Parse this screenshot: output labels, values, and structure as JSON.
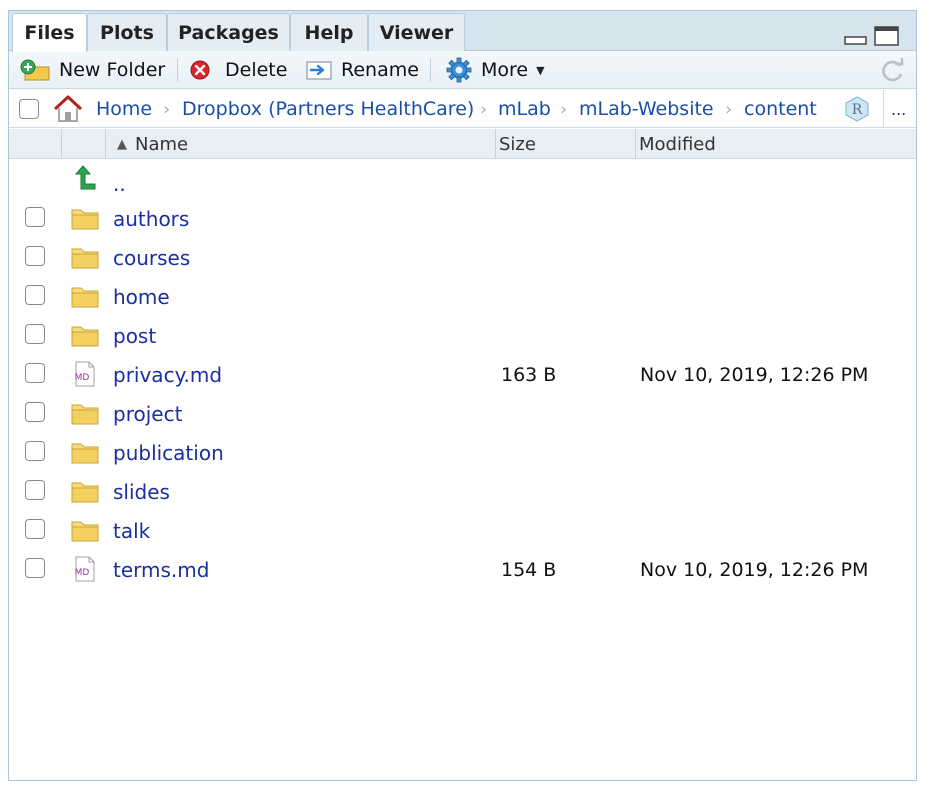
{
  "tabs": [
    {
      "label": "Files",
      "active": true
    },
    {
      "label": "Plots",
      "active": false
    },
    {
      "label": "Packages",
      "active": false
    },
    {
      "label": "Help",
      "active": false
    },
    {
      "label": "Viewer",
      "active": false
    }
  ],
  "toolbar": {
    "new_folder": "New Folder",
    "delete": "Delete",
    "rename": "Rename",
    "more": "More"
  },
  "breadcrumb": {
    "items": [
      "Home",
      "Dropbox (Partners HealthCare)",
      "mLab",
      "mLab-Website",
      "content"
    ],
    "overflow": "..."
  },
  "columns": {
    "name": "Name",
    "size": "Size",
    "modified": "Modified"
  },
  "parent_dir": "..",
  "files": [
    {
      "name": "authors",
      "type": "folder",
      "size": "",
      "modified": ""
    },
    {
      "name": "courses",
      "type": "folder",
      "size": "",
      "modified": ""
    },
    {
      "name": "home",
      "type": "folder",
      "size": "",
      "modified": ""
    },
    {
      "name": "post",
      "type": "folder",
      "size": "",
      "modified": ""
    },
    {
      "name": "privacy.md",
      "type": "markdown",
      "size": "163 B",
      "modified": "Nov 10, 2019, 12:26 PM"
    },
    {
      "name": "project",
      "type": "folder",
      "size": "",
      "modified": ""
    },
    {
      "name": "publication",
      "type": "folder",
      "size": "",
      "modified": ""
    },
    {
      "name": "slides",
      "type": "folder",
      "size": "",
      "modified": ""
    },
    {
      "name": "talk",
      "type": "folder",
      "size": "",
      "modified": ""
    },
    {
      "name": "terms.md",
      "type": "markdown",
      "size": "154 B",
      "modified": "Nov 10, 2019, 12:26 PM"
    }
  ],
  "icons": {
    "md_badge": "MD",
    "r_badge": "R"
  },
  "colors": {
    "link": "#1a2fa0",
    "tab_bg": "#d6e4ee",
    "folder": "#f2d36b"
  }
}
